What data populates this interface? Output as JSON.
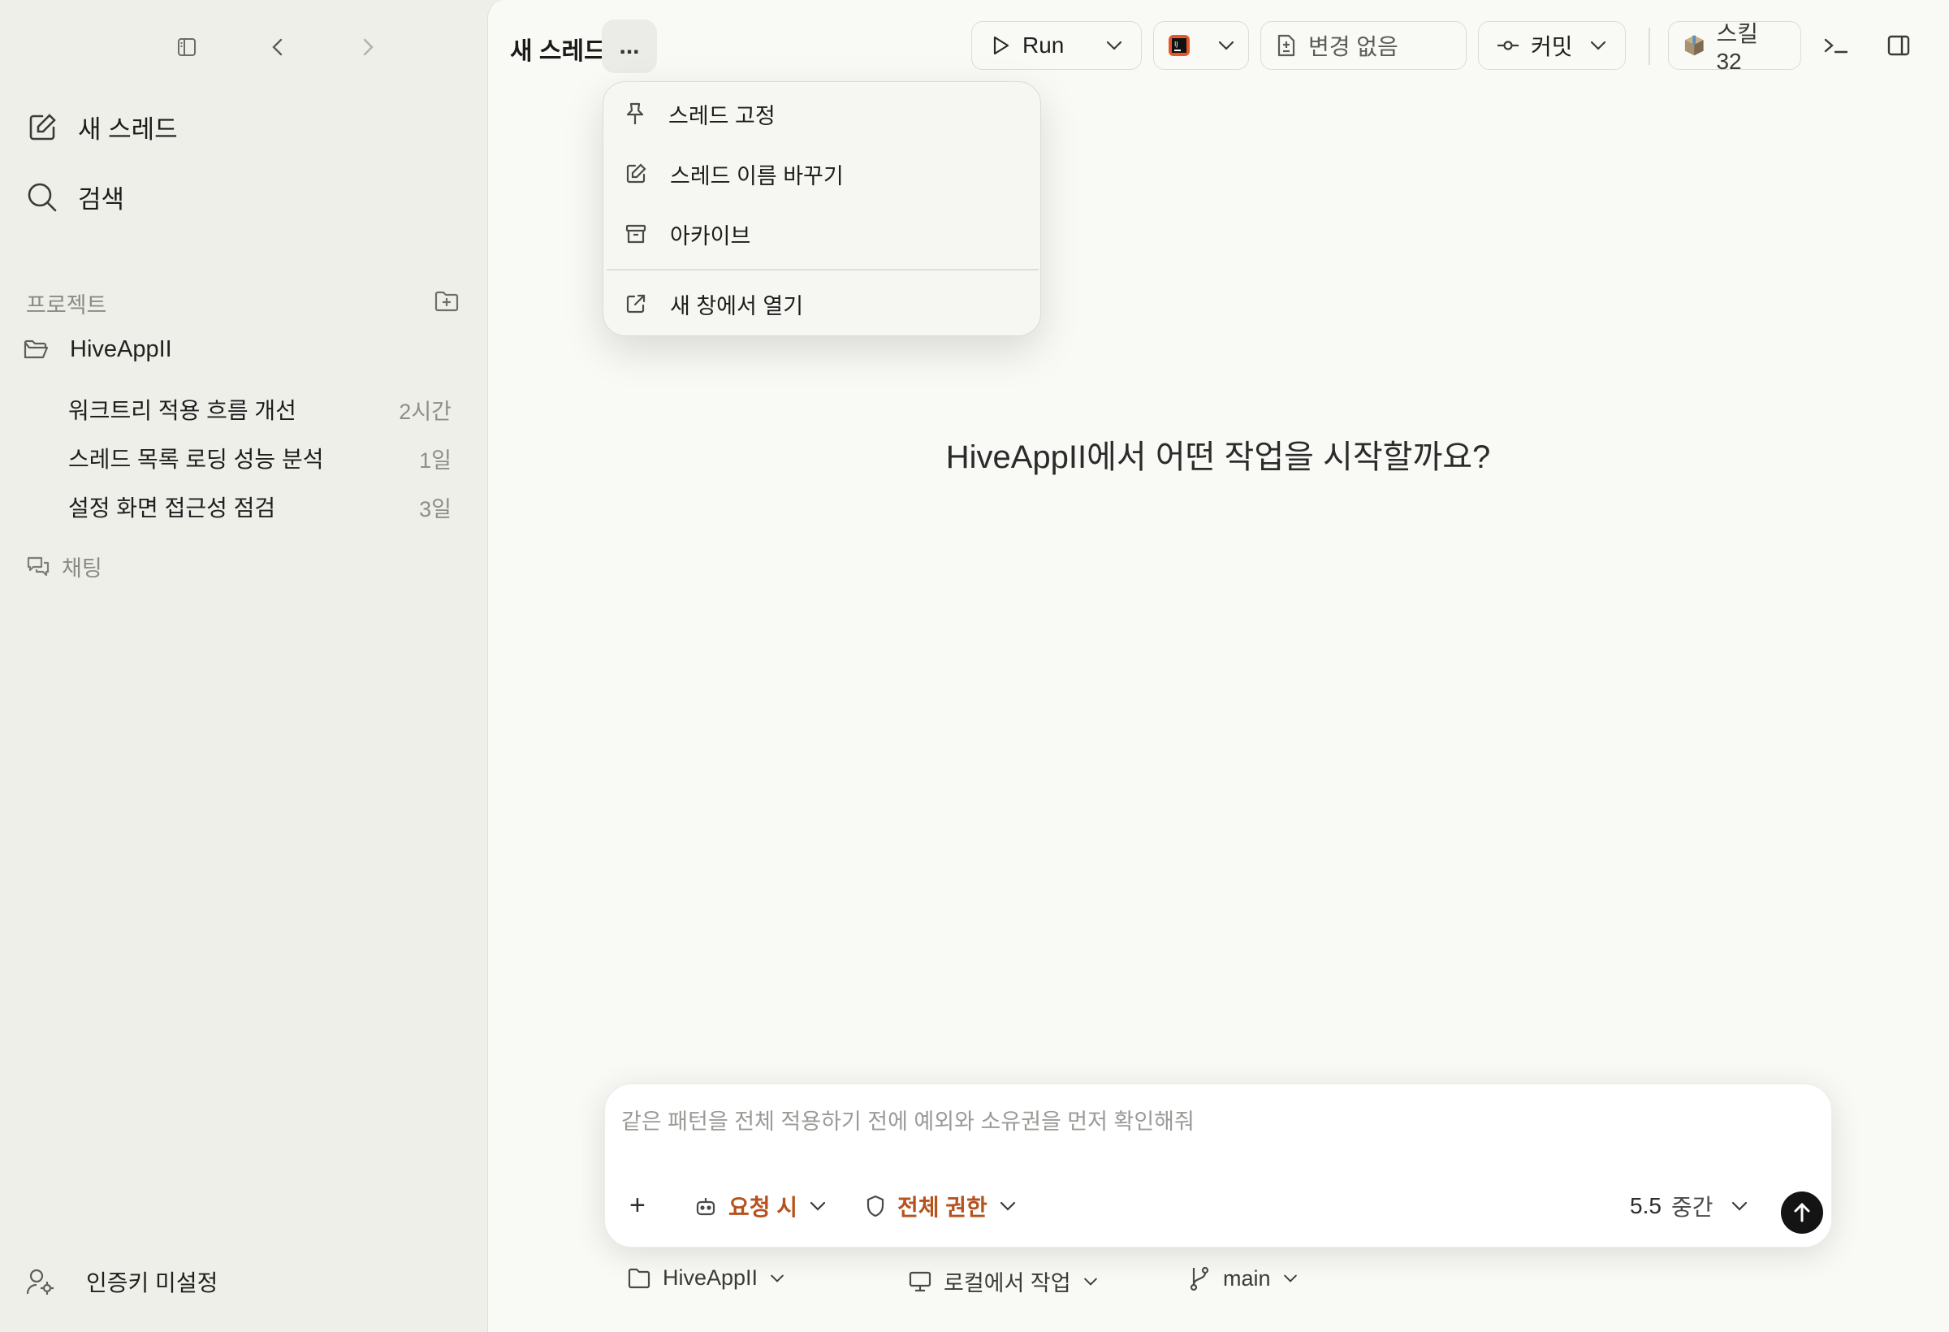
{
  "sidebar": {
    "new_thread": "새 스레드",
    "search": "검색",
    "projects_label": "프로젝트",
    "project_name": "HiveAppII",
    "threads": [
      {
        "title": "워크트리 적용 흐름 개선",
        "age": "2시간"
      },
      {
        "title": "스레드 목록 로딩 성능 분석",
        "age": "1일"
      },
      {
        "title": "설정 화면 접근성 점검",
        "age": "3일"
      }
    ],
    "chat_label": "채팅",
    "auth_status": "인증키 미설정"
  },
  "header": {
    "title": "새 스레드...",
    "run_label": "Run",
    "changes_label": "변경 없음",
    "commit_label": "커밋",
    "skills_label": "스킬 32"
  },
  "menu": {
    "items": [
      "스레드 고정",
      "스레드 이름 바꾸기",
      "아카이브",
      "새 창에서 열기"
    ]
  },
  "main": {
    "prompt_question": "HiveAppII에서 어떤 작업을 시작할까요?"
  },
  "composer": {
    "placeholder": "같은 패턴을 전체 적용하기 전에 예외와 소유권을 먼저 확인해줘",
    "approval_label": "요청 시",
    "permission_label": "전체 권한",
    "model_version": "5.5",
    "model_effort": "중간",
    "add_label": "+"
  },
  "footer": {
    "project": "HiveAppII",
    "environment": "로컬에서 작업",
    "branch": "main"
  },
  "colors": {
    "accent_orange": "#b5521e",
    "sidebar_bg": "#efefea",
    "main_bg": "#f9f9f6",
    "send_button": "#141414"
  }
}
